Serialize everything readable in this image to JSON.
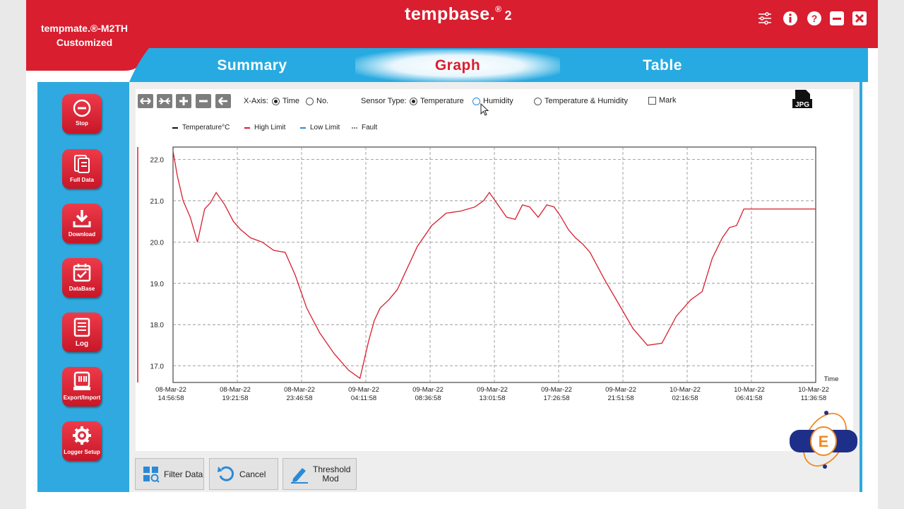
{
  "device": {
    "line1": "tempmate.®-M2TH",
    "line2": "Customized"
  },
  "app": {
    "name": "tempbase.",
    "reg": "®",
    "version": "2"
  },
  "window_controls": [
    "filter-sliders-icon",
    "info-icon",
    "help-icon",
    "minimize-icon",
    "close-icon"
  ],
  "tabs": [
    {
      "label": "Summary",
      "active": false
    },
    {
      "label": "Graph",
      "active": true
    },
    {
      "label": "Table",
      "active": false
    }
  ],
  "sidebar": {
    "items": [
      {
        "label": "Stop",
        "icon": "stop-icon"
      },
      {
        "label": "Full Data",
        "icon": "full-data-icon"
      },
      {
        "label": "Download",
        "icon": "download-icon"
      },
      {
        "label": "DataBase",
        "icon": "database-icon"
      },
      {
        "label": "Log",
        "icon": "log-icon"
      },
      {
        "label": "Export/Import",
        "icon": "export-import-icon"
      },
      {
        "label": "Logger Setup",
        "icon": "gear-icon"
      }
    ]
  },
  "toolbar": {
    "tools": [
      "expand-horizontal-icon",
      "shrink-horizontal-icon",
      "zoom-in-icon",
      "zoom-out-icon",
      "back-arrow-icon"
    ],
    "xaxis_label": "X-Axis:",
    "xaxis_time": "Time",
    "xaxis_no": "No.",
    "sensor_label": "Sensor Type:",
    "sensor_temperature": "Temperature",
    "sensor_humidity": "Humidity",
    "sensor_both": "Temperature & Humidity",
    "mark_label": "Mark",
    "jpg_label": "JPG",
    "xaxis_selected": "Time",
    "sensor_selected": "Temperature",
    "mark_checked": false
  },
  "legend": [
    {
      "label": "Temperature°C",
      "color": "#111111",
      "style": "solid"
    },
    {
      "label": "High Limit",
      "color": "#d81e2f",
      "style": "solid"
    },
    {
      "label": "Low Limit",
      "color": "#2b8ad6",
      "style": "solid"
    },
    {
      "label": "Fault",
      "color": "#888888",
      "style": "dotted"
    }
  ],
  "chart_data": {
    "type": "line",
    "xlabel": "Time",
    "ylabel": "",
    "ylim": [
      16.6,
      22.3
    ],
    "yticks": [
      "22.0",
      "21.0",
      "20.0",
      "19.0",
      "18.0",
      "17.0"
    ],
    "xtick_labels": [
      [
        "08-Mar-22",
        "14:56:58"
      ],
      [
        "08-Mar-22",
        "19:21:58"
      ],
      [
        "08-Mar-22",
        "23:46:58"
      ],
      [
        "09-Mar-22",
        "04:11:58"
      ],
      [
        "09-Mar-22",
        "08:36:58"
      ],
      [
        "09-Mar-22",
        "13:01:58"
      ],
      [
        "09-Mar-22",
        "17:26:58"
      ],
      [
        "09-Mar-22",
        "21:51:58"
      ],
      [
        "10-Mar-22",
        "02:16:58"
      ],
      [
        "10-Mar-22",
        "06:41:58"
      ],
      [
        "10-Mar-22",
        "11:36:58"
      ]
    ],
    "grid": true,
    "series": [
      {
        "name": "Temperature°C",
        "color": "#d81e2f",
        "x_hours": [
          0,
          0.3,
          0.7,
          1.2,
          1.7,
          2.2,
          2.6,
          3.0,
          3.6,
          4.2,
          4.7,
          5.4,
          6.2,
          7.0,
          7.8,
          8.5,
          9.3,
          10.2,
          11.2,
          12.2,
          13.0,
          13.6,
          14.0,
          14.4,
          15.0,
          15.6,
          16.2,
          17.0,
          18.0,
          19.0,
          20.0,
          21.0,
          21.6,
          22.0,
          22.6,
          23.2,
          23.8,
          24.3,
          24.8,
          25.4,
          26.0,
          26.5,
          27.0,
          27.5,
          28.0,
          28.5,
          29.0,
          30.0,
          31.0,
          32.0,
          33.0,
          34.0,
          35.0,
          36.0,
          36.8,
          37.5,
          38.2,
          38.7,
          39.2,
          39.7,
          40.2,
          41.0,
          42.0,
          43.0,
          43.8,
          44.3,
          44.7
        ],
        "values": [
          22.2,
          21.6,
          21.0,
          20.6,
          20.0,
          20.8,
          20.95,
          21.2,
          20.9,
          20.5,
          20.3,
          20.1,
          20.0,
          19.8,
          19.75,
          19.2,
          18.4,
          17.8,
          17.3,
          16.9,
          16.7,
          17.6,
          18.1,
          18.4,
          18.6,
          18.85,
          19.3,
          19.9,
          20.4,
          20.7,
          20.75,
          20.85,
          21.0,
          21.2,
          20.9,
          20.6,
          20.55,
          20.9,
          20.85,
          20.6,
          20.9,
          20.85,
          20.6,
          20.3,
          20.1,
          19.95,
          19.75,
          19.1,
          18.5,
          17.9,
          17.5,
          17.55,
          18.2,
          18.6,
          18.8,
          19.6,
          20.1,
          20.35,
          20.4,
          20.8,
          20.8,
          20.8,
          20.8,
          20.8,
          20.8,
          20.8,
          20.8
        ]
      }
    ]
  },
  "bottom_buttons": [
    {
      "label": "Filter Data",
      "icon": "filter-data-icon"
    },
    {
      "label": "Cancel",
      "icon": "cancel-undo-icon"
    },
    {
      "label": "Threshold Mod",
      "icon": "pen-edit-icon"
    }
  ],
  "colors": {
    "brand_red": "#d81e2f",
    "brand_blue": "#2fa9df",
    "logo_navy": "#1e2f8a",
    "logo_orange": "#f08a24"
  }
}
